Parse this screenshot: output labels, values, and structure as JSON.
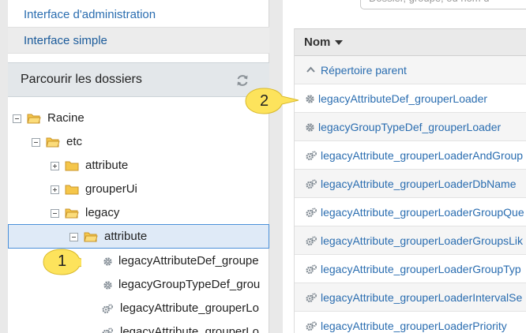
{
  "sidebar": {
    "nav_admin": "Interface d'administration",
    "nav_simple": "Interface simple",
    "browse_title": "Parcourir les dossiers",
    "tree": {
      "root": "Racine",
      "etc": "etc",
      "attribute": "attribute",
      "grouperUi": "grouperUi",
      "legacy": "legacy",
      "legacy_attribute": "attribute",
      "item1": "legacyAttributeDef_groupe",
      "item2": "legacyGroupTypeDef_grou",
      "item3": "legacyAttribute_grouperLo",
      "item4": "legacyAttribute_grouperLo"
    }
  },
  "main": {
    "search_placeholder": "Dossier, groupe, ou nom d",
    "column_name": "Nom",
    "parent_link": "Répertoire parent",
    "rows": [
      "legacyAttributeDef_grouperLoader",
      "legacyGroupTypeDef_grouperLoader",
      "legacyAttribute_grouperLoaderAndGroup",
      "legacyAttribute_grouperLoaderDbName",
      "legacyAttribute_grouperLoaderGroupQue",
      "legacyAttribute_grouperLoaderGroupsLik",
      "legacyAttribute_grouperLoaderGroupTyp",
      "legacyAttribute_grouperLoaderIntervalSe",
      "legacyAttribute_grouperLoaderPriority"
    ]
  },
  "callouts": {
    "one": "1",
    "two": "2"
  },
  "colors": {
    "link": "#2a6db0",
    "callout": "#fde35c",
    "selected": "#dfeaf7"
  }
}
